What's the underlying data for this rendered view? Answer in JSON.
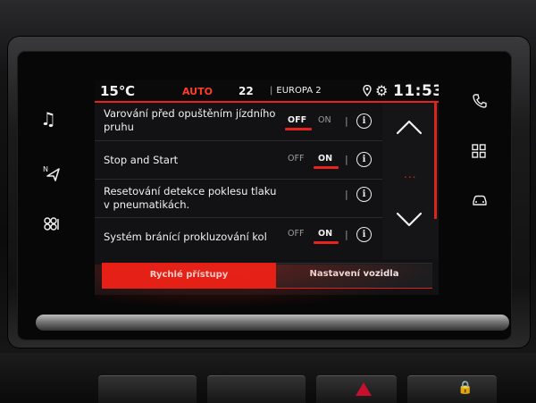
{
  "status_bar": {
    "temperature": "15℃",
    "climate_mode": "AUTO",
    "fan_value": "22",
    "radio_station": "EUROPA 2",
    "time": "11:53",
    "separator": "|"
  },
  "settings_rows": [
    {
      "label": "Varování před opuštěním jízdního pruhu",
      "toggle": true,
      "off_label": "OFF",
      "on_label": "ON",
      "state": "off"
    },
    {
      "label": "Stop and Start",
      "toggle": true,
      "off_label": "OFF",
      "on_label": "ON",
      "state": "on"
    },
    {
      "label": "Resetování detekce poklesu tlaku v pneumatikách.",
      "toggle": false
    },
    {
      "label": "Systém bránící prokluzování kol",
      "toggle": true,
      "off_label": "OFF",
      "on_label": "ON",
      "state": "on"
    }
  ],
  "info_glyph": "i",
  "scroll_dots": "...",
  "tabs": {
    "quick_access": "Rychlé přístupy",
    "vehicle_settings": "Nastavení vozidla",
    "active": "quick_access"
  },
  "icons": {
    "left": [
      "music-icon",
      "navigation-icon",
      "fan-icon"
    ],
    "right": [
      "phone-icon",
      "apps-grid-icon",
      "car-icon"
    ]
  },
  "colors": {
    "accent": "#e51f16",
    "background": "#121214",
    "text": "#f1f1f1"
  }
}
